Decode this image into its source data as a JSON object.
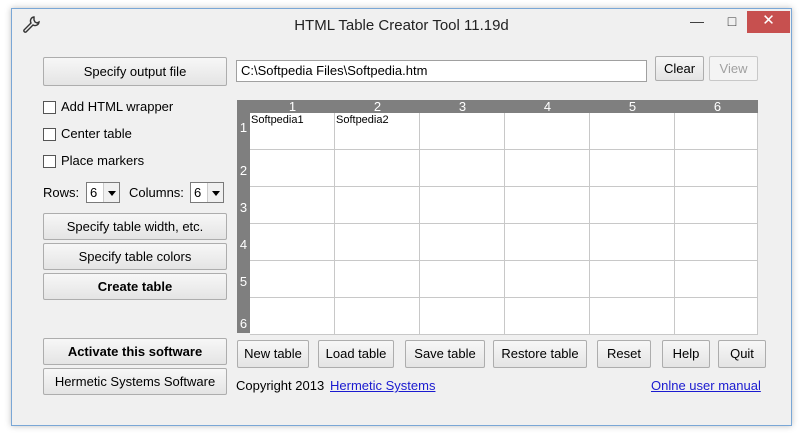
{
  "window": {
    "title": "HTML Table Creator Tool 11.19d"
  },
  "titlebar": {
    "minimize": "—",
    "maximize": "□",
    "close": "✕"
  },
  "output": {
    "specify_label": "Specify output file",
    "path_value": "C:\\Softpedia Files\\Softpedia.htm",
    "clear_label": "Clear",
    "view_label": "View"
  },
  "options": {
    "add_wrapper": "Add HTML wrapper",
    "center_table": "Center table",
    "place_markers": "Place markers",
    "rows_label": "Rows:",
    "rows_value": "6",
    "columns_label": "Columns:",
    "columns_value": "6"
  },
  "left_buttons": {
    "width": "Specify table width, etc.",
    "colors": "Specify table colors",
    "create": "Create table",
    "activate": "Activate this software",
    "hermetic": "Hermetic Systems Software"
  },
  "grid": {
    "columns": [
      "1",
      "2",
      "3",
      "4",
      "5",
      "6"
    ],
    "rows": [
      "1",
      "2",
      "3",
      "4",
      "5",
      "6"
    ],
    "cells": [
      [
        "Softpedia1",
        "Softpedia2",
        "",
        "",
        "",
        ""
      ],
      [
        "",
        "",
        "",
        "",
        "",
        ""
      ],
      [
        "",
        "",
        "",
        "",
        "",
        ""
      ],
      [
        "",
        "",
        "",
        "",
        "",
        ""
      ],
      [
        "",
        "",
        "",
        "",
        "",
        ""
      ],
      [
        "",
        "",
        "",
        "",
        "",
        ""
      ]
    ]
  },
  "bottom_buttons": {
    "new_table": "New table",
    "load_table": "Load table",
    "save_table": "Save table",
    "restore_table": "Restore table",
    "reset": "Reset",
    "help": "Help",
    "quit": "Quit"
  },
  "footer": {
    "copyright": "Copyright 2013",
    "company_link": "Hermetic Systems",
    "manual_link": "Onlne user manual"
  },
  "colors": {
    "grid_header": "#7f7f7f",
    "close_button": "#c7504f",
    "link": "#1a1ad0"
  }
}
